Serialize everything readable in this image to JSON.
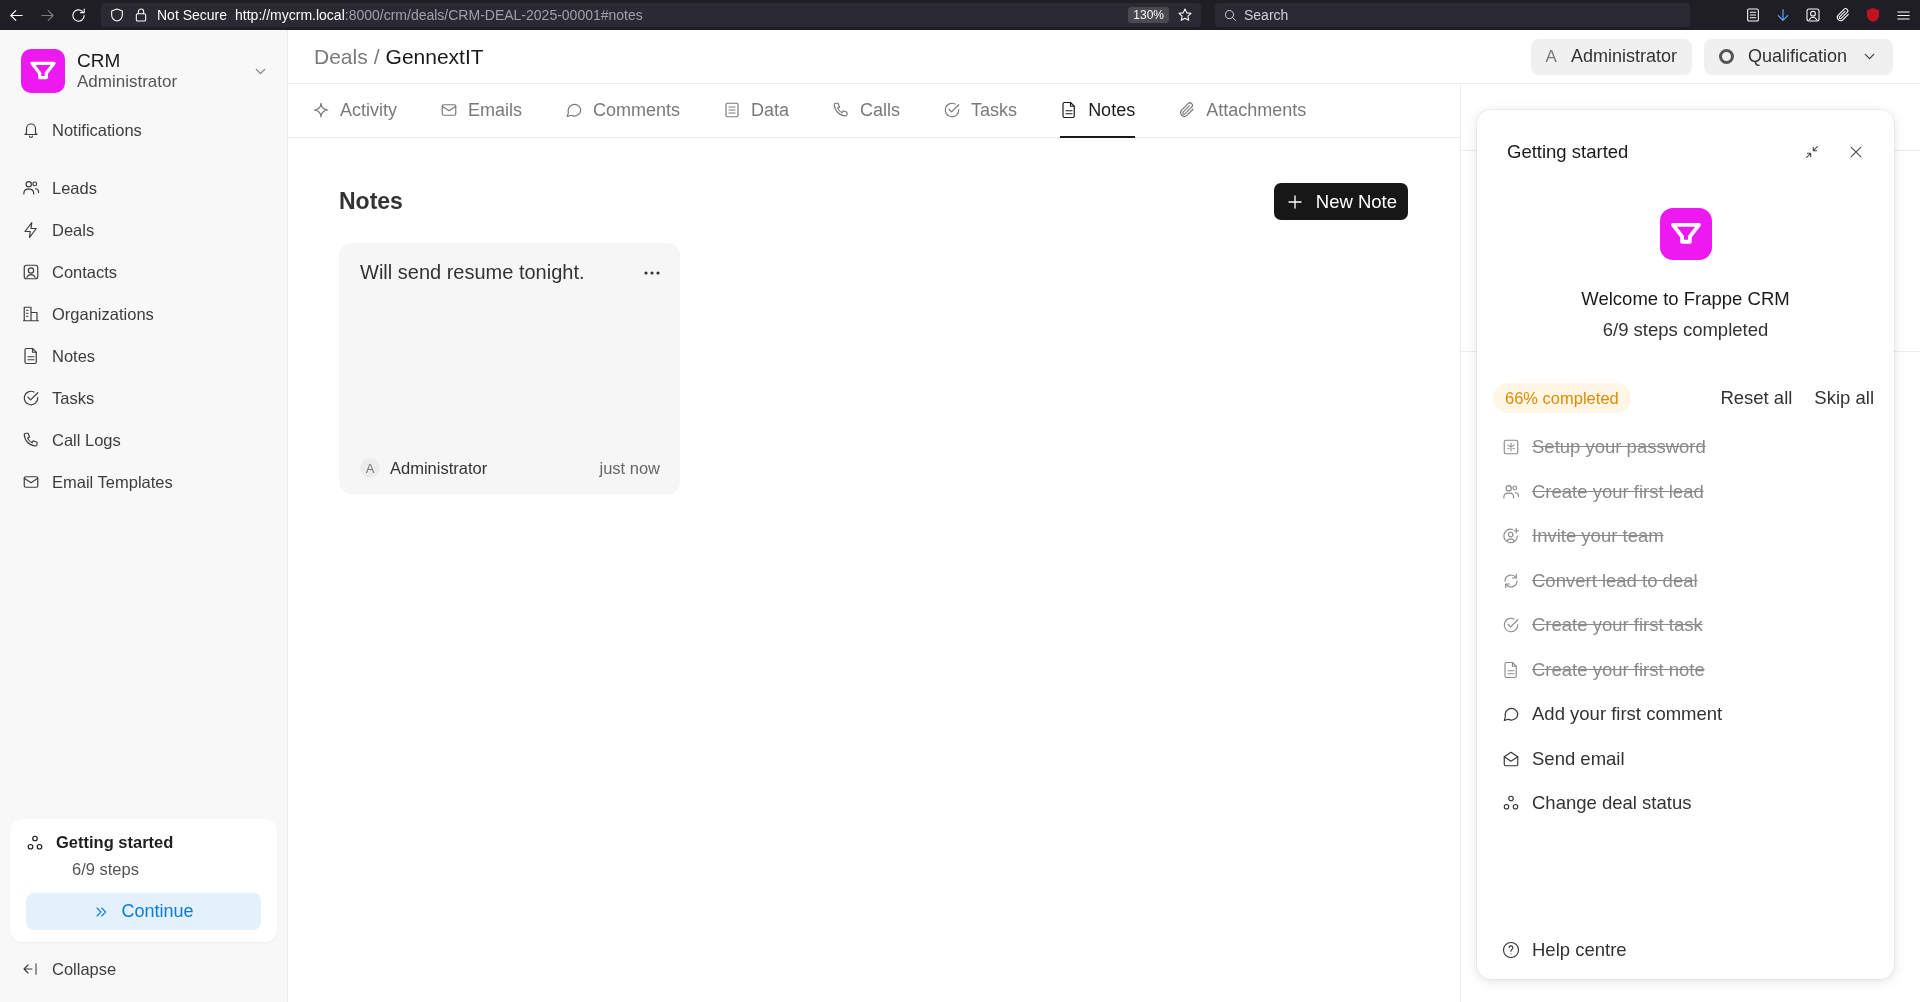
{
  "browser": {
    "security": "Not Secure",
    "url_host": "http://mycrm.local",
    "url_path": ":8000/crm/deals/CRM-DEAL-2025-00001#notes",
    "zoom": "130%",
    "search_placeholder": "Search"
  },
  "sidebar": {
    "app_title": "CRM",
    "app_user": "Administrator",
    "notifications": "Notifications",
    "items": [
      {
        "label": "Leads",
        "selected": false
      },
      {
        "label": "Deals",
        "selected": false
      },
      {
        "label": "Contacts",
        "selected": false
      },
      {
        "label": "Organizations",
        "selected": false
      },
      {
        "label": "Notes",
        "selected": false
      },
      {
        "label": "Tasks",
        "selected": false
      },
      {
        "label": "Call Logs",
        "selected": false
      },
      {
        "label": "Email Templates",
        "selected": false
      }
    ],
    "onboarding": {
      "title": "Getting started",
      "progress": "6/9 steps",
      "button": "Continue"
    },
    "collapse": "Collapse"
  },
  "header": {
    "breadcrumb_parent": "Deals",
    "breadcrumb_separator": "/",
    "breadcrumb_current": "GennextIT",
    "assignee_initial": "A",
    "assignee": "Administrator",
    "status": "Qualification"
  },
  "tabs": [
    {
      "label": "Activity",
      "selected": false
    },
    {
      "label": "Emails",
      "selected": false
    },
    {
      "label": "Comments",
      "selected": false
    },
    {
      "label": "Data",
      "selected": false
    },
    {
      "label": "Calls",
      "selected": false
    },
    {
      "label": "Tasks",
      "selected": false
    },
    {
      "label": "Notes",
      "selected": true
    },
    {
      "label": "Attachments",
      "selected": false
    }
  ],
  "notes": {
    "title": "Notes",
    "new_button": "New Note",
    "items": [
      {
        "text": "Will send resume tonight.",
        "author_initial": "A",
        "author": "Administrator",
        "time": "just now"
      }
    ]
  },
  "onboarding_panel": {
    "title": "Getting started",
    "welcome": "Welcome to Frappe CRM",
    "progress": "6/9 steps completed",
    "badge": "66% completed",
    "reset": "Reset all",
    "skip": "Skip all",
    "steps": [
      {
        "label": "Setup your password",
        "done": true
      },
      {
        "label": "Create your first lead",
        "done": true
      },
      {
        "label": "Invite your team",
        "done": true
      },
      {
        "label": "Convert lead to deal",
        "done": true
      },
      {
        "label": "Create your first task",
        "done": true
      },
      {
        "label": "Create your first note",
        "done": true
      },
      {
        "label": "Add your first comment",
        "done": false
      },
      {
        "label": "Send email",
        "done": false
      },
      {
        "label": "Change deal status",
        "done": false
      }
    ],
    "help": "Help centre"
  }
}
